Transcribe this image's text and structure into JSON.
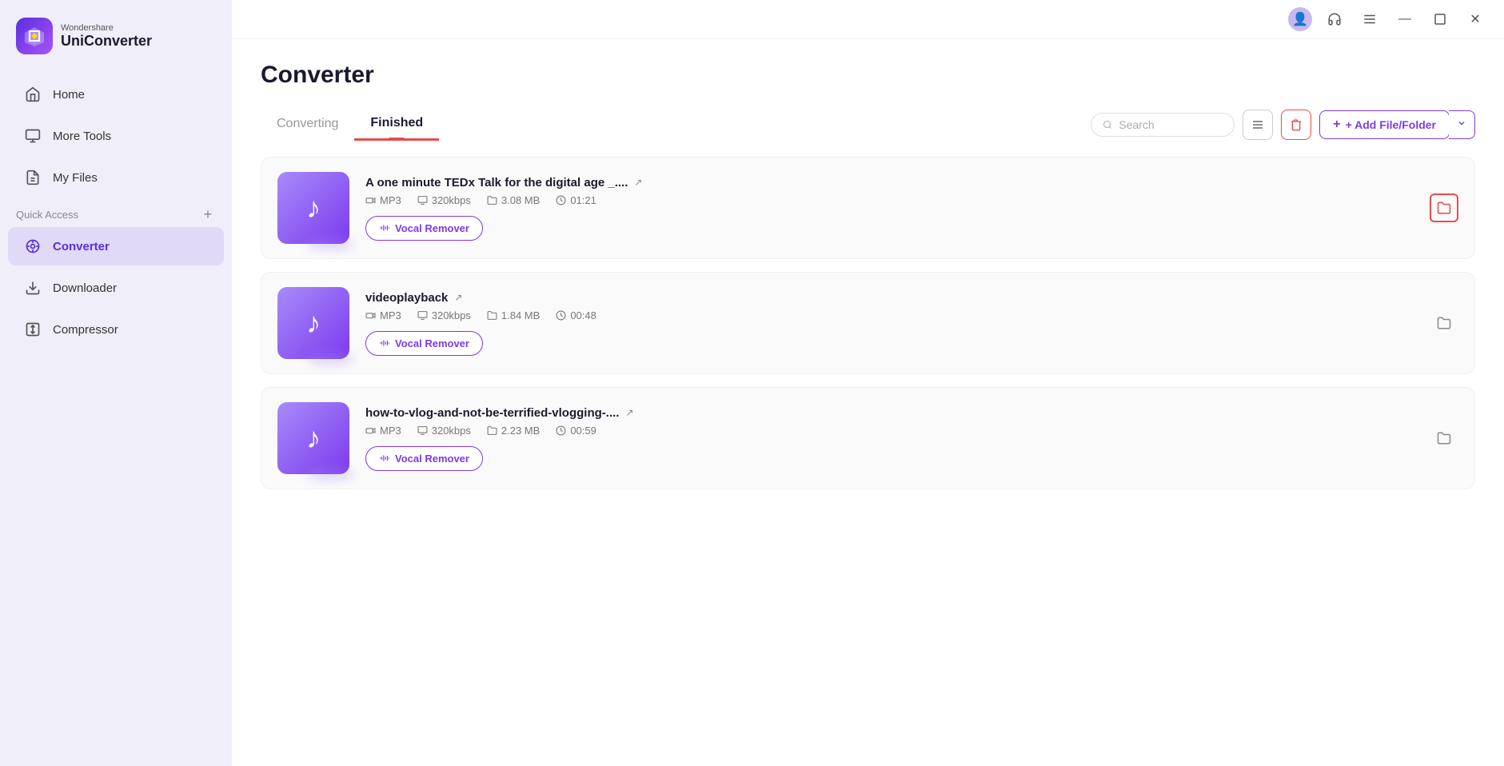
{
  "app": {
    "brand": "Wondershare",
    "product": "UniConverter"
  },
  "sidebar": {
    "nav_items": [
      {
        "id": "home",
        "label": "Home",
        "icon": "home"
      },
      {
        "id": "more-tools",
        "label": "More Tools",
        "icon": "more-tools"
      },
      {
        "id": "my-files",
        "label": "My Files",
        "icon": "my-files"
      }
    ],
    "quick_access_label": "Quick Access",
    "quick_access_add": "+",
    "converter_label": "Converter",
    "downloader_label": "Downloader",
    "compressor_label": "Compressor"
  },
  "page": {
    "title": "Converter",
    "tabs": [
      {
        "id": "converting",
        "label": "Converting"
      },
      {
        "id": "finished",
        "label": "Finished"
      }
    ],
    "active_tab": "finished"
  },
  "toolbar": {
    "search_placeholder": "Search",
    "list_icon": "≡",
    "delete_label": "🗑",
    "add_label": "+ Add File/Folder",
    "dropdown_icon": "▾"
  },
  "files": [
    {
      "id": "file-1",
      "name": "A one minute TEDx Talk for the digital age _....",
      "format": "MP3",
      "bitrate": "320kbps",
      "size": "3.08 MB",
      "duration": "01:21",
      "folder_highlighted": true
    },
    {
      "id": "file-2",
      "name": "videoplayback",
      "format": "MP3",
      "bitrate": "320kbps",
      "size": "1.84 MB",
      "duration": "00:48",
      "folder_highlighted": false
    },
    {
      "id": "file-3",
      "name": "how-to-vlog-and-not-be-terrified-vlogging-....",
      "format": "MP3",
      "bitrate": "320kbps",
      "size": "2.23 MB",
      "duration": "00:59",
      "folder_highlighted": false
    }
  ],
  "vocal_remover_label": "Vocal Remover"
}
